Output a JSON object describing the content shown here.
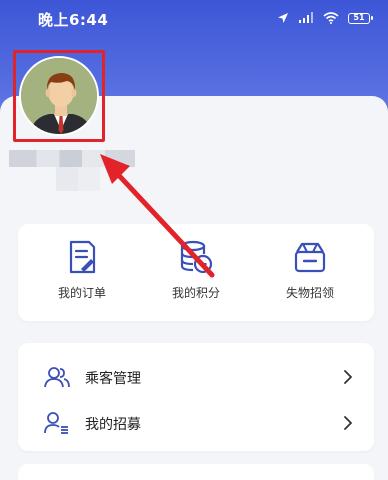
{
  "status_bar": {
    "time": "晚上6:44",
    "battery": "51"
  },
  "profile": {
    "avatar_icon": "person-avatar-icon"
  },
  "quick_actions": [
    {
      "label": "我的订单",
      "icon": "order-document-icon"
    },
    {
      "label": "我的积分",
      "icon": "points-coins-icon"
    },
    {
      "label": "失物招领",
      "icon": "lost-and-found-box-icon"
    }
  ],
  "menu": [
    {
      "label": "乘客管理",
      "icon": "passengers-icon"
    },
    {
      "label": "我的招募",
      "icon": "recruit-person-icon"
    }
  ],
  "colors": {
    "header_blue": "#3d56d6",
    "highlight_red": "#e2232a",
    "icon_blue": "#3a4fb8"
  }
}
